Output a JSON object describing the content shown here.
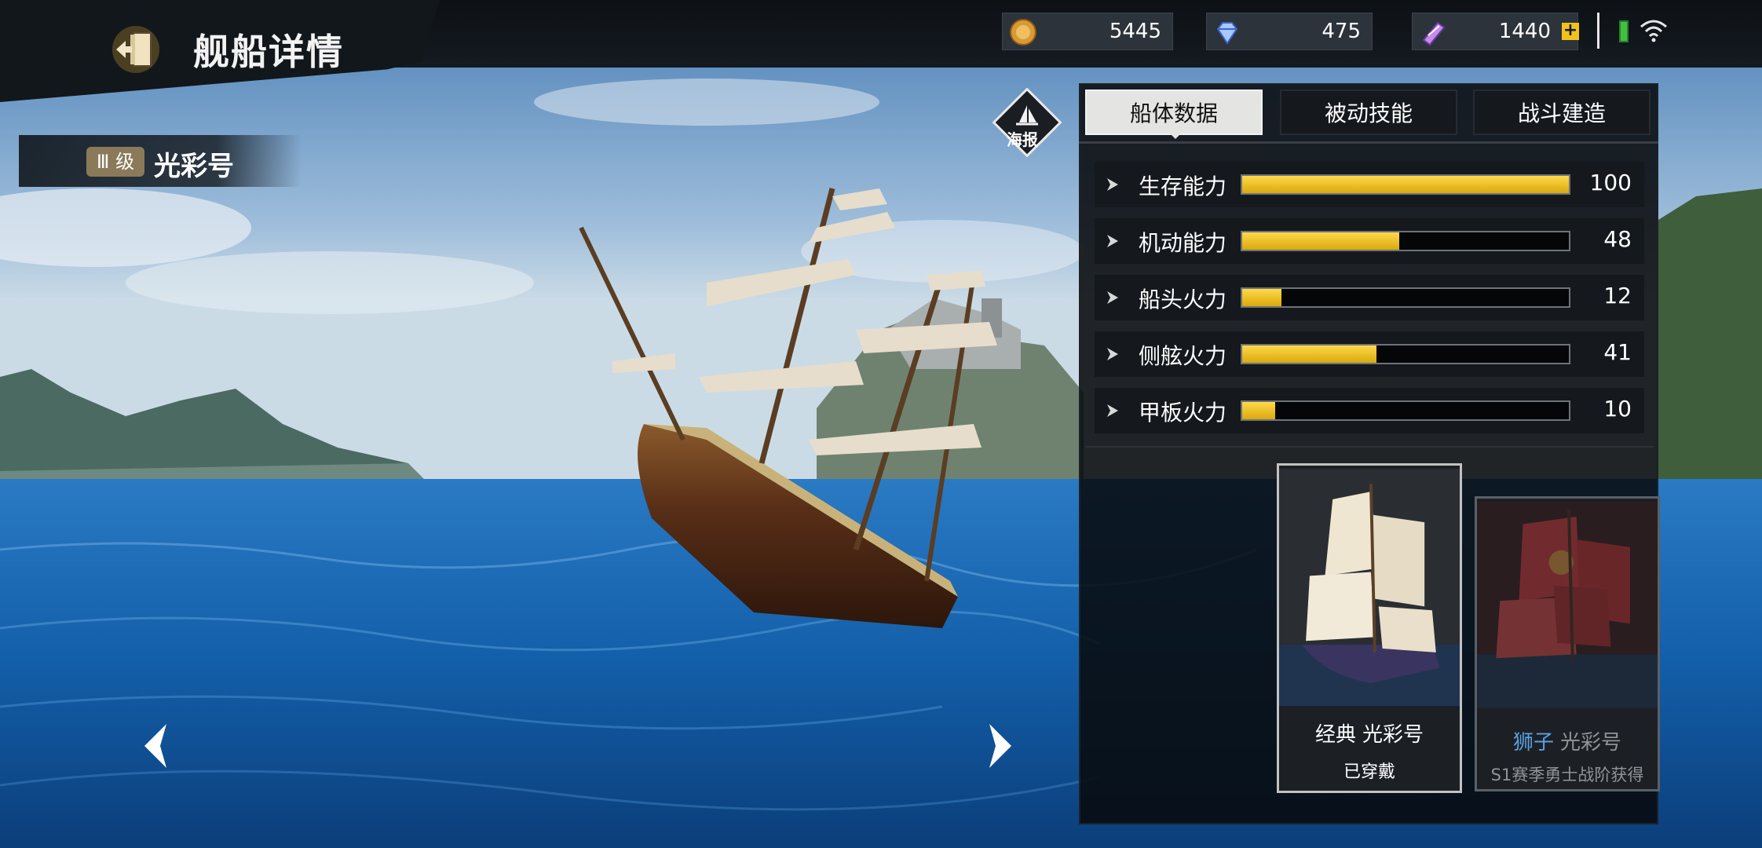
{
  "header": {
    "title": "舰船详情"
  },
  "resources": {
    "gold": "5445",
    "diamond": "475",
    "ticket": "1440"
  },
  "ship": {
    "grade": "Ⅲ 级",
    "name": "光彩号"
  },
  "poster": {
    "label": "海报"
  },
  "tabs": [
    {
      "label": "船体数据",
      "active": true
    },
    {
      "label": "被动技能",
      "active": false
    },
    {
      "label": "战斗建造",
      "active": false
    }
  ],
  "stats": [
    {
      "label": "生存能力",
      "value": 100
    },
    {
      "label": "机动能力",
      "value": 48
    },
    {
      "label": "船头火力",
      "value": 12
    },
    {
      "label": "侧舷火力",
      "value": 41
    },
    {
      "label": "甲板火力",
      "value": 10
    }
  ],
  "skins": [
    {
      "prefix": "经典",
      "name": "光彩号",
      "status": "已穿戴",
      "selected": true
    },
    {
      "prefix": "狮子",
      "name": "光彩号",
      "status": "S1赛季勇士战阶获得",
      "selected": false
    }
  ],
  "colors": {
    "bar_fill": "#ffd84a",
    "accent_gold": "#f1c21b",
    "skin_prefix_locked": "#5aa0e0"
  }
}
